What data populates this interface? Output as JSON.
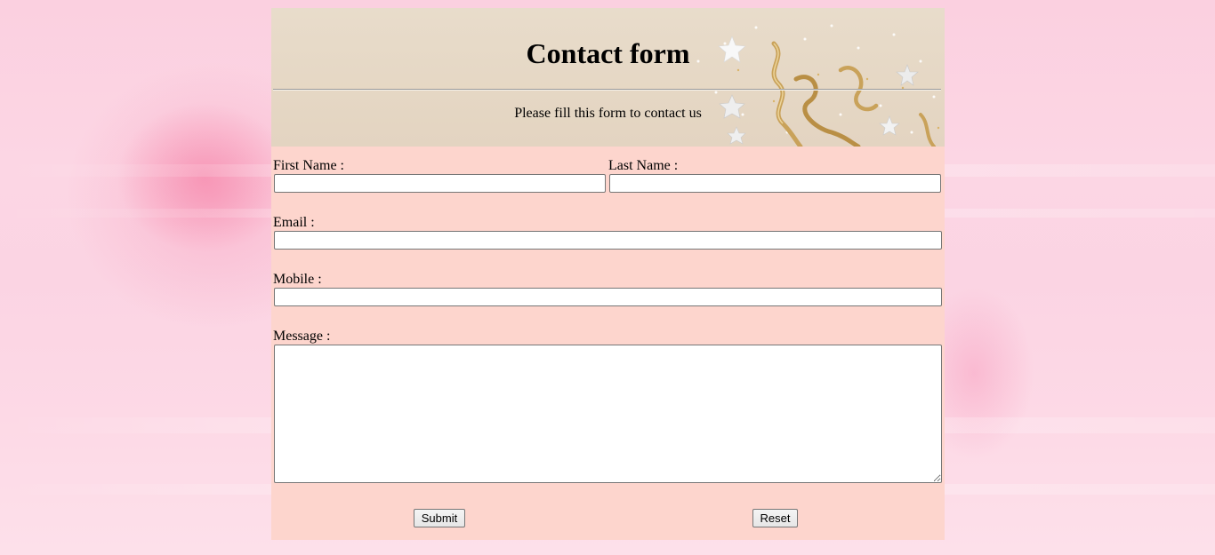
{
  "header": {
    "title": "Contact form",
    "subtitle": "Please fill this form to contact us"
  },
  "form": {
    "first_name_label": "First Name :",
    "first_name_value": "",
    "last_name_label": "Last Name :",
    "last_name_value": "",
    "email_label": "Email :",
    "email_value": "",
    "mobile_label": "Mobile :",
    "mobile_value": "",
    "message_label": "Message :",
    "message_value": "",
    "submit_label": "Submit",
    "reset_label": "Reset"
  },
  "colors": {
    "page_background": "#fbd0e0",
    "form_background": "#fdd5cd",
    "header_background": "#e8dccb",
    "ribbon_gold": "#c9a25a"
  },
  "decorations": {
    "header_art": [
      "star-icon",
      "gold-ribbon-icon",
      "confetti-dots"
    ],
    "page_background_art": "pink-flower-watercolor"
  }
}
